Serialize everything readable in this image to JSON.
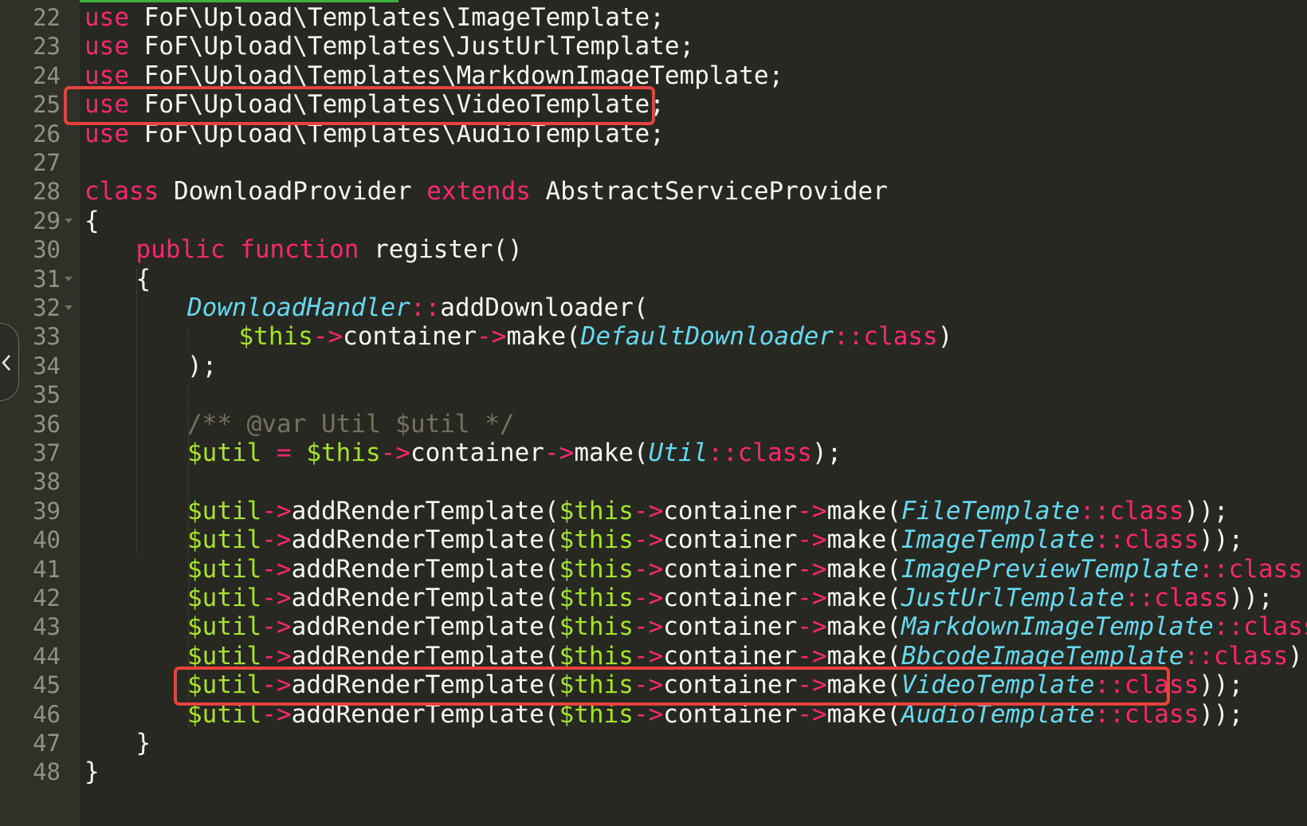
{
  "editor": {
    "lines": [
      {
        "number": "22",
        "fold": false,
        "indent": 0,
        "tokens": [
          [
            "kw",
            "use"
          ],
          [
            "txt",
            " FoF\\Upload\\Templates\\ImageTemplate;"
          ]
        ]
      },
      {
        "number": "23",
        "fold": false,
        "indent": 0,
        "tokens": [
          [
            "kw",
            "use"
          ],
          [
            "txt",
            " FoF\\Upload\\Templates\\JustUrlTemplate;"
          ]
        ]
      },
      {
        "number": "24",
        "fold": false,
        "indent": 0,
        "tokens": [
          [
            "kw",
            "use"
          ],
          [
            "txt",
            " FoF\\Upload\\Templates\\MarkdownImageTemplate;"
          ]
        ]
      },
      {
        "number": "25",
        "fold": false,
        "indent": 0,
        "tokens": [
          [
            "kw",
            "use"
          ],
          [
            "txt",
            " FoF\\Upload\\Templates\\VideoTemplate;"
          ]
        ]
      },
      {
        "number": "26",
        "fold": false,
        "indent": 0,
        "tokens": [
          [
            "kw",
            "use"
          ],
          [
            "txt",
            " FoF\\Upload\\Templates\\AudioTemplate;"
          ]
        ]
      },
      {
        "number": "27",
        "fold": false,
        "indent": 0,
        "tokens": []
      },
      {
        "number": "28",
        "fold": false,
        "indent": 0,
        "tokens": [
          [
            "kw",
            "class"
          ],
          [
            "txt",
            " DownloadProvider "
          ],
          [
            "kw",
            "extends"
          ],
          [
            "txt",
            " AbstractServiceProvider"
          ]
        ]
      },
      {
        "number": "29",
        "fold": true,
        "indent": 0,
        "tokens": [
          [
            "txt",
            "{"
          ]
        ]
      },
      {
        "number": "30",
        "fold": false,
        "indent": 1,
        "tokens": [
          [
            "kw",
            "public"
          ],
          [
            "txt",
            " "
          ],
          [
            "kw",
            "function"
          ],
          [
            "txt",
            " register()"
          ]
        ]
      },
      {
        "number": "31",
        "fold": true,
        "indent": 1,
        "tokens": [
          [
            "txt",
            "{"
          ]
        ]
      },
      {
        "number": "32",
        "fold": true,
        "indent": 2,
        "tokens": [
          [
            "cls",
            "DownloadHandler"
          ],
          [
            "op",
            "::"
          ],
          [
            "txt",
            "addDownloader("
          ]
        ]
      },
      {
        "number": "33",
        "fold": false,
        "indent": 3,
        "tokens": [
          [
            "var",
            "$this"
          ],
          [
            "op",
            "->"
          ],
          [
            "txt",
            "container"
          ],
          [
            "op",
            "->"
          ],
          [
            "txt",
            "make("
          ],
          [
            "cls",
            "DefaultDownloader"
          ],
          [
            "op",
            "::class"
          ],
          [
            "txt",
            ")"
          ]
        ]
      },
      {
        "number": "34",
        "fold": false,
        "indent": 2,
        "tokens": [
          [
            "txt",
            ");"
          ]
        ]
      },
      {
        "number": "35",
        "fold": false,
        "indent": 0,
        "tokens": []
      },
      {
        "number": "36",
        "fold": false,
        "indent": 2,
        "tokens": [
          [
            "cm",
            "/** @var Util $util */"
          ]
        ]
      },
      {
        "number": "37",
        "fold": false,
        "indent": 2,
        "tokens": [
          [
            "var",
            "$util"
          ],
          [
            "txt",
            " "
          ],
          [
            "op",
            "="
          ],
          [
            "txt",
            " "
          ],
          [
            "var",
            "$this"
          ],
          [
            "op",
            "->"
          ],
          [
            "txt",
            "container"
          ],
          [
            "op",
            "->"
          ],
          [
            "txt",
            "make("
          ],
          [
            "cls",
            "Util"
          ],
          [
            "op",
            "::class"
          ],
          [
            "txt",
            ");"
          ]
        ]
      },
      {
        "number": "38",
        "fold": false,
        "indent": 0,
        "tokens": []
      },
      {
        "number": "39",
        "fold": false,
        "indent": 2,
        "tokens": [
          [
            "var",
            "$util"
          ],
          [
            "op",
            "->"
          ],
          [
            "txt",
            "addRenderTemplate("
          ],
          [
            "var",
            "$this"
          ],
          [
            "op",
            "->"
          ],
          [
            "txt",
            "container"
          ],
          [
            "op",
            "->"
          ],
          [
            "txt",
            "make("
          ],
          [
            "cls",
            "FileTemplate"
          ],
          [
            "op",
            "::class"
          ],
          [
            "txt",
            "));"
          ]
        ]
      },
      {
        "number": "40",
        "fold": false,
        "indent": 2,
        "tokens": [
          [
            "var",
            "$util"
          ],
          [
            "op",
            "->"
          ],
          [
            "txt",
            "addRenderTemplate("
          ],
          [
            "var",
            "$this"
          ],
          [
            "op",
            "->"
          ],
          [
            "txt",
            "container"
          ],
          [
            "op",
            "->"
          ],
          [
            "txt",
            "make("
          ],
          [
            "cls",
            "ImageTemplate"
          ],
          [
            "op",
            "::class"
          ],
          [
            "txt",
            "));"
          ]
        ]
      },
      {
        "number": "41",
        "fold": false,
        "indent": 2,
        "tokens": [
          [
            "var",
            "$util"
          ],
          [
            "op",
            "->"
          ],
          [
            "txt",
            "addRenderTemplate("
          ],
          [
            "var",
            "$this"
          ],
          [
            "op",
            "->"
          ],
          [
            "txt",
            "container"
          ],
          [
            "op",
            "->"
          ],
          [
            "txt",
            "make("
          ],
          [
            "cls",
            "ImagePreviewTemplate"
          ],
          [
            "op",
            "::class"
          ],
          [
            "txt",
            "));"
          ]
        ]
      },
      {
        "number": "42",
        "fold": false,
        "indent": 2,
        "tokens": [
          [
            "var",
            "$util"
          ],
          [
            "op",
            "->"
          ],
          [
            "txt",
            "addRenderTemplate("
          ],
          [
            "var",
            "$this"
          ],
          [
            "op",
            "->"
          ],
          [
            "txt",
            "container"
          ],
          [
            "op",
            "->"
          ],
          [
            "txt",
            "make("
          ],
          [
            "cls",
            "JustUrlTemplate"
          ],
          [
            "op",
            "::class"
          ],
          [
            "txt",
            "));"
          ]
        ]
      },
      {
        "number": "43",
        "fold": false,
        "indent": 2,
        "tokens": [
          [
            "var",
            "$util"
          ],
          [
            "op",
            "->"
          ],
          [
            "txt",
            "addRenderTemplate("
          ],
          [
            "var",
            "$this"
          ],
          [
            "op",
            "->"
          ],
          [
            "txt",
            "container"
          ],
          [
            "op",
            "->"
          ],
          [
            "txt",
            "make("
          ],
          [
            "cls",
            "MarkdownImageTemplate"
          ],
          [
            "op",
            "::class"
          ],
          [
            "txt",
            "));"
          ]
        ]
      },
      {
        "number": "44",
        "fold": false,
        "indent": 2,
        "tokens": [
          [
            "var",
            "$util"
          ],
          [
            "op",
            "->"
          ],
          [
            "txt",
            "addRenderTemplate("
          ],
          [
            "var",
            "$this"
          ],
          [
            "op",
            "->"
          ],
          [
            "txt",
            "container"
          ],
          [
            "op",
            "->"
          ],
          [
            "txt",
            "make("
          ],
          [
            "cls",
            "BbcodeImageTemplate"
          ],
          [
            "op",
            "::class"
          ],
          [
            "txt",
            "));"
          ]
        ]
      },
      {
        "number": "45",
        "fold": false,
        "indent": 2,
        "tokens": [
          [
            "var",
            "$util"
          ],
          [
            "op",
            "->"
          ],
          [
            "txt",
            "addRenderTemplate("
          ],
          [
            "var",
            "$this"
          ],
          [
            "op",
            "->"
          ],
          [
            "txt",
            "container"
          ],
          [
            "op",
            "->"
          ],
          [
            "txt",
            "make("
          ],
          [
            "cls",
            "VideoTemplate"
          ],
          [
            "op",
            "::class"
          ],
          [
            "txt",
            "));"
          ]
        ]
      },
      {
        "number": "46",
        "fold": false,
        "indent": 2,
        "tokens": [
          [
            "var",
            "$util"
          ],
          [
            "op",
            "->"
          ],
          [
            "txt",
            "addRenderTemplate("
          ],
          [
            "var",
            "$this"
          ],
          [
            "op",
            "->"
          ],
          [
            "txt",
            "container"
          ],
          [
            "op",
            "->"
          ],
          [
            "txt",
            "make("
          ],
          [
            "cls",
            "AudioTemplate"
          ],
          [
            "op",
            "::class"
          ],
          [
            "txt",
            "));"
          ]
        ]
      },
      {
        "number": "47",
        "fold": false,
        "indent": 1,
        "tokens": [
          [
            "txt",
            "}"
          ]
        ]
      },
      {
        "number": "48",
        "fold": false,
        "indent": 0,
        "tokens": [
          [
            "txt",
            "}"
          ]
        ]
      }
    ],
    "highlighted_lines": [
      "25",
      "45"
    ],
    "colors": {
      "background": "#272822",
      "gutter": "#2f3129",
      "keyword": "#f92672",
      "class_name": "#66d9ef",
      "variable": "#a6e22e",
      "comment": "#75715e",
      "text": "#f8f8f2",
      "highlight_box": "#e8423c"
    },
    "side_tab_icon": "chevron-left-icon"
  }
}
